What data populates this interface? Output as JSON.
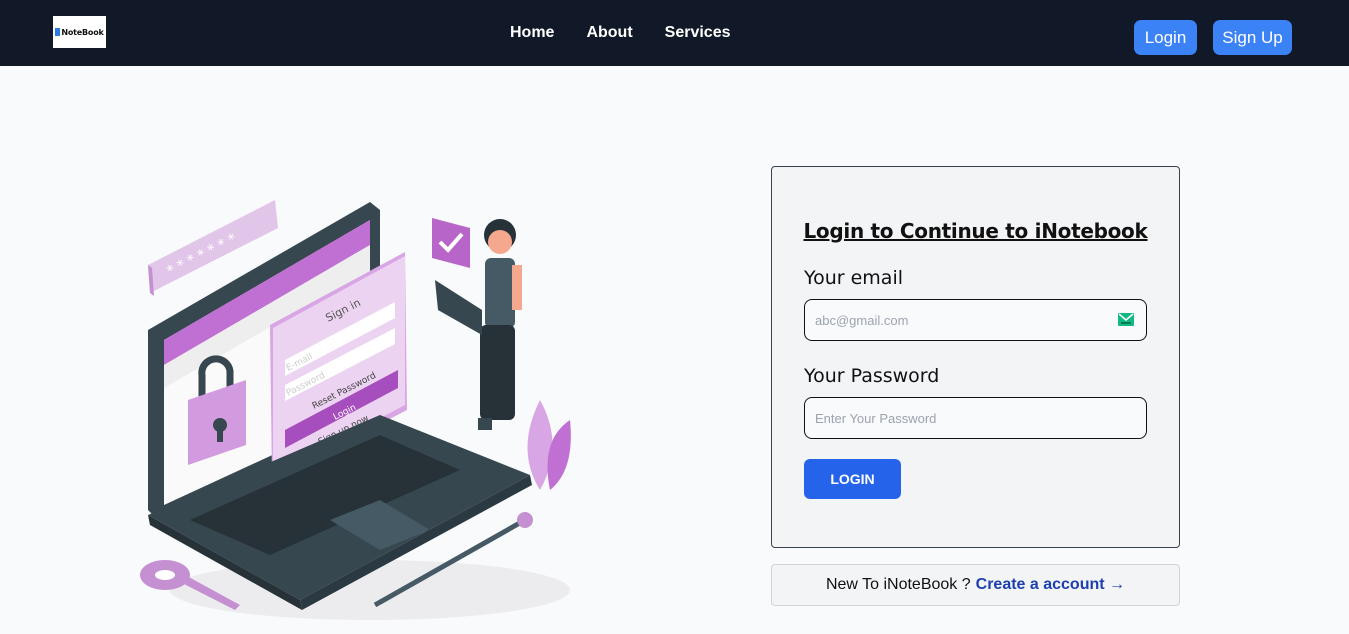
{
  "brand": {
    "logo_text": "NoteBook",
    "logo_icon": "book-icon"
  },
  "nav": {
    "links": [
      "Home",
      "About",
      "Services"
    ]
  },
  "header_buttons": {
    "login_label": "Login",
    "signup_label": "Sign Up"
  },
  "illustration": {
    "icon": "secure-login-illustration",
    "screen_title": "Sign in",
    "email_placeholder": "E-mail",
    "password_placeholder": "Password",
    "reset_text": "Reset Password",
    "login_text": "Login",
    "signup_text": "Sign up now",
    "password_mask": "* * * * * * *"
  },
  "form": {
    "title": "Login to Continue to iNotebook",
    "email_label": "Your email",
    "email_placeholder": "abc@gmail.com",
    "email_icon": "mail-icon",
    "password_label": "Your Password",
    "password_placeholder": "Enter Your Password",
    "submit_label": "LOGIN"
  },
  "signup_prompt": {
    "text": "New To iNoteBook ?",
    "link_text": "Create a account →"
  },
  "colors": {
    "navbar": "#111827",
    "accent": "#3b82f6",
    "submit": "#2563eb",
    "illustration_purple": "#b865c9",
    "link": "#1e40af"
  }
}
